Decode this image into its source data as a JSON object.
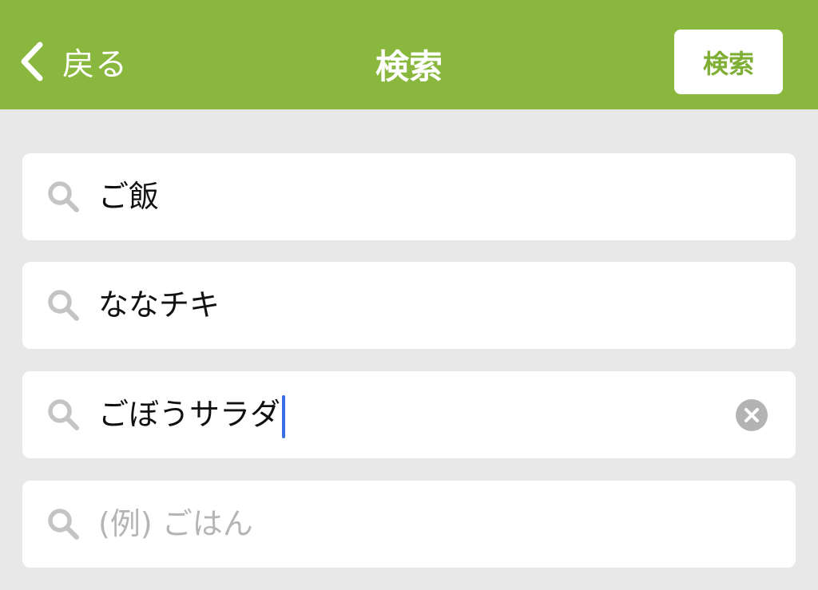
{
  "colors": {
    "navbar": "#8ab83f",
    "accent_text": "#7fae35",
    "background": "#e8e8e8",
    "caret": "#3a6fe8"
  },
  "navbar": {
    "back_label": "戻る",
    "title": "検索",
    "search_button_label": "検索"
  },
  "fields": [
    {
      "value": "ご飯",
      "icon": "search-icon"
    },
    {
      "value": "ななチキ",
      "icon": "search-icon"
    },
    {
      "value": "ごぼうサラダ",
      "icon": "search-icon",
      "focused": true,
      "clear_icon": "clear-icon"
    },
    {
      "value": "",
      "placeholder": "(例) ごはん",
      "icon": "search-icon"
    }
  ]
}
